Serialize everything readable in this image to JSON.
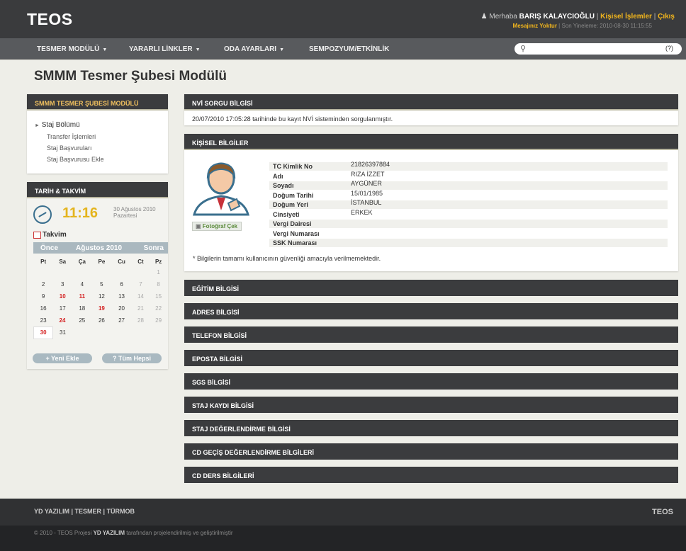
{
  "header": {
    "logo": "TEOS",
    "greeting": "Merhaba",
    "user_name": "BARIŞ KALAYCIOĞLU",
    "personal_link": "Kişisel İşlemler",
    "logout_link": "Çıkış",
    "message_status": "Mesajınız Yoktur",
    "last_update": "Son Yineleme: 2010-08-30 11:15:55"
  },
  "nav": {
    "items": [
      "TESMER MODÜLÜ",
      "YARARLI LİNKLER",
      "ODA AYARLARI",
      "SEMPOZYUM/ETKİNLİK"
    ],
    "search_placeholder": "",
    "search_help": "(?)"
  },
  "page": {
    "title": "SMMM Tesmer Şubesi Modülü"
  },
  "sidebar": {
    "module_title": "SMMM TESMER ŞUBESİ MODÜLÜ",
    "main_item": "Staj Bölümü",
    "sub_items": [
      "Transfer İşlemleri",
      "Staj Başvuruları",
      "Staj Başvurusu Ekle"
    ],
    "date_title": "TARİH & TAKVİM",
    "clock_time": "11:16",
    "clock_date": "30 Ağustos 2010",
    "clock_day": "Pazartesi",
    "calendar_label": "Takvim",
    "calendar_prev": "Önce",
    "calendar_month": "Ağustos 2010",
    "calendar_next": "Sonra",
    "weekdays": [
      "Pt",
      "Sa",
      "Ça",
      "Pe",
      "Cu",
      "Ct",
      "Pz"
    ],
    "weeks": [
      [
        "",
        "",
        "",
        "",
        "",
        "",
        "1"
      ],
      [
        "2",
        "3",
        "4",
        "5",
        "6",
        "7",
        "8"
      ],
      [
        "9",
        "10",
        "11",
        "12",
        "13",
        "14",
        "15"
      ],
      [
        "16",
        "17",
        "18",
        "19",
        "20",
        "21",
        "22"
      ],
      [
        "23",
        "24",
        "25",
        "26",
        "27",
        "28",
        "29"
      ],
      [
        "30",
        "31",
        "",
        "",
        "",
        "",
        ""
      ]
    ],
    "red_days": [
      "10",
      "11",
      "19",
      "24",
      "30"
    ],
    "today": "30",
    "add_button": "+ Yeni Ekle",
    "all_button": "? Tüm Hepsi"
  },
  "nvi": {
    "title": "NVİ SORGU BİLGİSİ",
    "message": "20/07/2010 17:05:28 tarihinde bu kayıt NVİ sisteminden sorgulanmıştır."
  },
  "personal": {
    "title": "KİŞİSEL BİLGİLER",
    "photo_button": "Fotoğraf Çek",
    "fields": [
      {
        "label": "TC Kimlik No",
        "value": "21826397884"
      },
      {
        "label": "Adı",
        "value": "RIZA İZZET"
      },
      {
        "label": "Soyadı",
        "value": "AYGÜNER"
      },
      {
        "label": "Doğum Tarihi",
        "value": "15/01/1985"
      },
      {
        "label": "Doğum Yeri",
        "value": "İSTANBUL"
      },
      {
        "label": "Cinsiyeti",
        "value": "ERKEK"
      },
      {
        "label": "Vergi Dairesi",
        "value": ""
      },
      {
        "label": "Vergi Numarası",
        "value": ""
      },
      {
        "label": "SSK Numarası",
        "value": ""
      }
    ],
    "note": "* Bilgilerin tamamı kullanıcının güvenliği amacıyla verilmemektedir."
  },
  "sections": [
    "EĞİTİM BİLGİSİ",
    "ADRES BİLGİSİ",
    "TELEFON BİLGİSİ",
    "EPOSTA BİLGİSİ",
    "SGS BİLGİSİ",
    "STAJ KAYDI BİLGİSİ",
    "STAJ DEĞERLENDİRME BİLGİSİ",
    "CD GEÇİŞ DEĞERLENDİRME BİLGİLERİ",
    "CD DERS BİLGİLERİ"
  ],
  "footer": {
    "links": "YD YAZILIM | TESMER | TÜRMOB",
    "logo": "TEOS",
    "copyright_pre": "© 2010 - TEOS Projesi",
    "copyright_company": "YD YAZILIM",
    "copyright_post": "tarafından projelendirilmiş ve geliştirilmiştir"
  },
  "colors": {
    "accent": "#f1b51d",
    "dark": "#3b3c3e",
    "red": "#d42020"
  }
}
